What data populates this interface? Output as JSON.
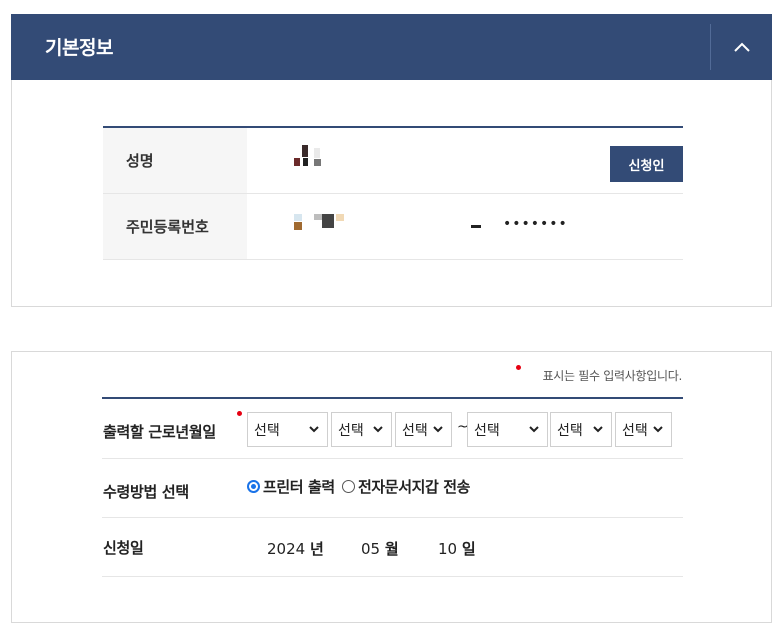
{
  "basic_info": {
    "title": "기본정보",
    "name_label": "성명",
    "applicant_button": "신청인",
    "rrn_label": "주민등록번호",
    "rrn_masked": "•••••••"
  },
  "form": {
    "required_note": "표시는 필수 입력사항입니다.",
    "period_label": "출력할 근로년월일",
    "select_placeholder": "선택",
    "range_separator": "~",
    "receive_label": "수령방법 선택",
    "receive_options": [
      {
        "label": "프린터 출력",
        "selected": true
      },
      {
        "label": "전자문서지갑 전송",
        "selected": false
      }
    ],
    "date_label": "신청일",
    "date": {
      "year": "2024",
      "year_unit": "년",
      "month": "05",
      "month_unit": "월",
      "day": "10",
      "day_unit": "일"
    }
  },
  "colors": {
    "accent": "#334b76",
    "required": "#e60012",
    "radio": "#1a73e8"
  }
}
